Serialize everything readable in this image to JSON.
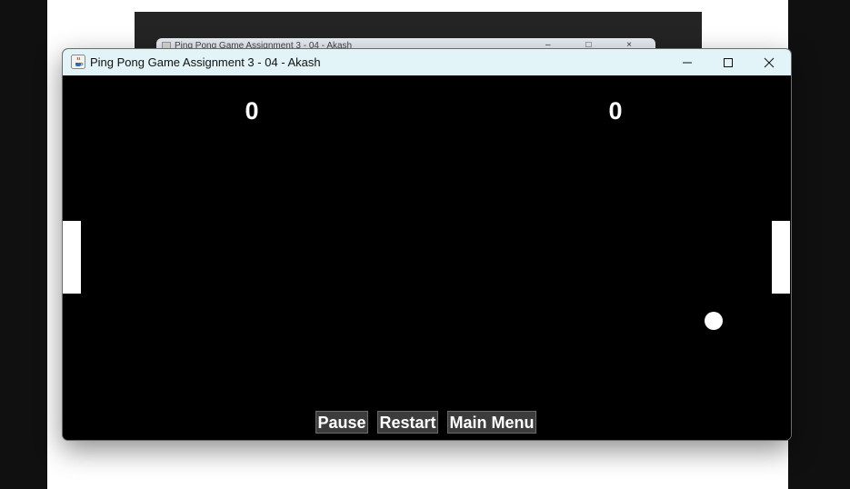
{
  "background": {
    "ghost_window_title": "Ping Pong Game Assignment 3 - 04 - Akash"
  },
  "window": {
    "title": "Ping Pong Game Assignment 3 - 04 - Akash",
    "icon": "java-cup-icon",
    "controls": {
      "minimize": "minimize-icon",
      "maximize": "maximize-icon",
      "close": "close-icon"
    },
    "titlebar_color": "#e2f4f7"
  },
  "game": {
    "background_color": "#000000",
    "foreground_color": "#ffffff",
    "score_left": "0",
    "score_right": "0",
    "buttons": {
      "pause": "Pause",
      "restart": "Restart",
      "main_menu": "Main Menu"
    }
  }
}
